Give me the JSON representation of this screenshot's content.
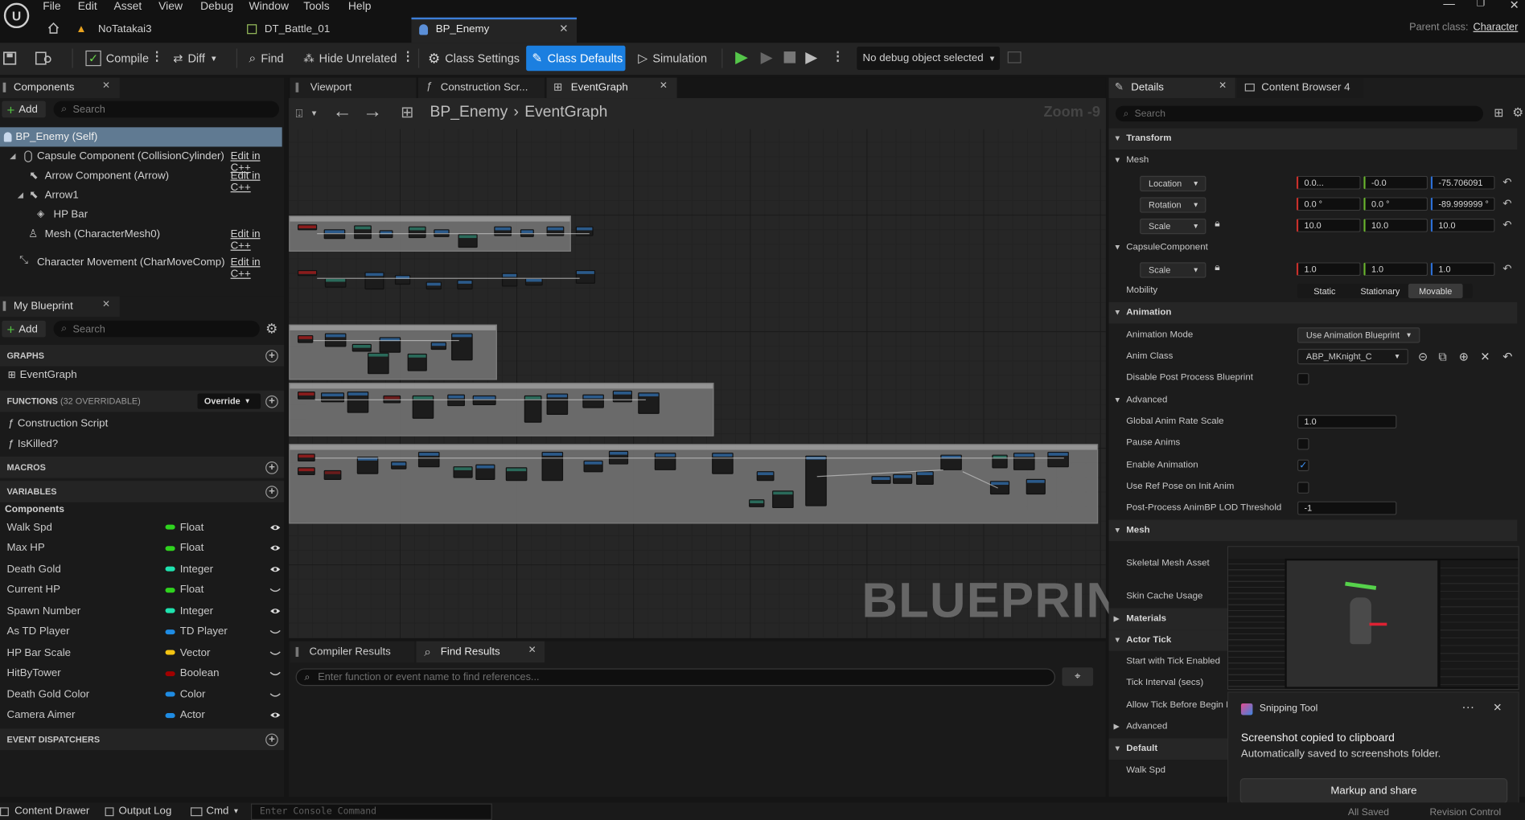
{
  "menu": [
    "File",
    "Edit",
    "Asset",
    "View",
    "Debug",
    "Window",
    "Tools",
    "Help"
  ],
  "doc_tabs": [
    {
      "label": "NoTatakai3"
    },
    {
      "label": "DT_Battle_01"
    },
    {
      "label": "BP_Enemy"
    }
  ],
  "parent_class": {
    "label": "Parent class:",
    "value": "Character"
  },
  "toolbar": {
    "compile": "Compile",
    "diff": "Diff",
    "find": "Find",
    "hide_unrelated": "Hide Unrelated",
    "class_settings": "Class Settings",
    "class_defaults": "Class Defaults",
    "simulation": "Simulation",
    "debug_object": "No debug object selected"
  },
  "components": {
    "title": "Components",
    "add": "Add",
    "search_placeholder": "Search",
    "items": [
      {
        "label": "BP_Enemy (Self)"
      },
      {
        "label": "Capsule Component (CollisionCylinder)",
        "edit": "Edit in C++"
      },
      {
        "label": "Arrow Component (Arrow)",
        "edit": "Edit in C++"
      },
      {
        "label": "Arrow1"
      },
      {
        "label": "HP Bar"
      },
      {
        "label": "Mesh (CharacterMesh0)",
        "edit": "Edit in C++"
      },
      {
        "label": "Character Movement (CharMoveComp)",
        "edit": "Edit in C++"
      }
    ]
  },
  "my_blueprint": {
    "title": "My Blueprint",
    "add": "Add",
    "search_placeholder": "Search",
    "graphs": "GRAPHS",
    "event_graph": "EventGraph",
    "functions": "FUNCTIONS",
    "functions_count": "(32 OVERRIDABLE)",
    "override": "Override",
    "function_items": [
      "Construction Script",
      "IsKilled?"
    ],
    "macros": "MACROS",
    "variables": "VARIABLES",
    "var_category": "Components",
    "vars": [
      {
        "name": "Walk Spd",
        "type": "Float",
        "color": "#2fd31f"
      },
      {
        "name": "Max HP",
        "type": "Float",
        "color": "#2fd31f"
      },
      {
        "name": "Death Gold",
        "type": "Integer",
        "color": "#1fe3af"
      },
      {
        "name": "Current HP",
        "type": "Float",
        "color": "#2fd31f"
      },
      {
        "name": "Spawn Number",
        "type": "Integer",
        "color": "#1fe3af"
      },
      {
        "name": "As TD Player",
        "type": "TD Player",
        "color": "#1f8ce3"
      },
      {
        "name": "HP Bar Scale",
        "type": "Vector",
        "color": "#f3c312"
      },
      {
        "name": "HitByTower",
        "type": "Boolean",
        "color": "#a10000"
      },
      {
        "name": "Death Gold Color",
        "type": "Color",
        "color": "#1f8ce3"
      },
      {
        "name": "Camera Aimer",
        "type": "Actor",
        "color": "#1f8ce3"
      }
    ],
    "dispatchers": "EVENT DISPATCHERS"
  },
  "editor_tabs": [
    {
      "label": "Viewport"
    },
    {
      "label": "Construction Scr..."
    },
    {
      "label": "EventGraph"
    }
  ],
  "graph": {
    "breadcrumb_root": "BP_Enemy",
    "breadcrumb_leaf": "EventGraph",
    "zoom": "Zoom -9",
    "watermark": "BLUEPRINT"
  },
  "bottom_tabs": [
    {
      "label": "Compiler Results"
    },
    {
      "label": "Find Results"
    }
  ],
  "find": {
    "placeholder": "Enter function or event name to find references..."
  },
  "details": {
    "title": "Details",
    "content_browser": "Content Browser 4",
    "search_placeholder": "Search",
    "transform": "Transform",
    "mesh": "Mesh",
    "location": {
      "label": "Location",
      "x": "0.0...",
      "y": "-0.0",
      "z": "-75.706091"
    },
    "rotation": {
      "label": "Rotation",
      "x": "0.0 °",
      "y": "0.0 °",
      "z": "-89.999999 °"
    },
    "scale": {
      "label": "Scale",
      "x": "10.0",
      "y": "10.0",
      "z": "10.0"
    },
    "capsule": "CapsuleComponent",
    "capsule_scale": {
      "label": "Scale",
      "x": "1.0",
      "y": "1.0",
      "z": "1.0"
    },
    "mobility": {
      "label": "Mobility",
      "options": [
        "Static",
        "Stationary",
        "Movable"
      ]
    },
    "animation": "Animation",
    "anim_mode": {
      "label": "Animation Mode",
      "value": "Use Animation Blueprint"
    },
    "anim_class": {
      "label": "Anim Class",
      "value": "ABP_MKnight_C"
    },
    "disable_pp": "Disable Post Process Blueprint",
    "advanced": "Advanced",
    "global_rate": {
      "label": "Global Anim Rate Scale",
      "value": "1.0"
    },
    "pause_anims": "Pause Anims",
    "enable_anim": "Enable Animation",
    "use_ref_pose": "Use Ref Pose on Init Anim",
    "lod_threshold": {
      "label": "Post-Process AnimBP LOD Threshold",
      "value": "-1"
    },
    "mesh2": "Mesh",
    "skeletal_mesh": "Skeletal Mesh Asset",
    "skin_cache": "Skin Cache Usage",
    "materials": "Materials",
    "actor_tick": "Actor Tick",
    "start_tick": "Start with Tick Enabled",
    "tick_interval": "Tick Interval (secs)",
    "allow_tick": "Allow Tick Before Begin P",
    "advanced2": "Advanced",
    "default": "Default",
    "walk_spd": "Walk Spd"
  },
  "snipping": {
    "app": "Snipping Tool",
    "title": "Screenshot copied to clipboard",
    "subtitle": "Automatically saved to screenshots folder.",
    "button": "Markup and share"
  },
  "statusbar": {
    "content_drawer": "Content Drawer",
    "output_log": "Output Log",
    "cmd": "Cmd",
    "console_placeholder": "Enter Console Command",
    "right_1": "All Saved",
    "right_2": "Revision Control"
  }
}
